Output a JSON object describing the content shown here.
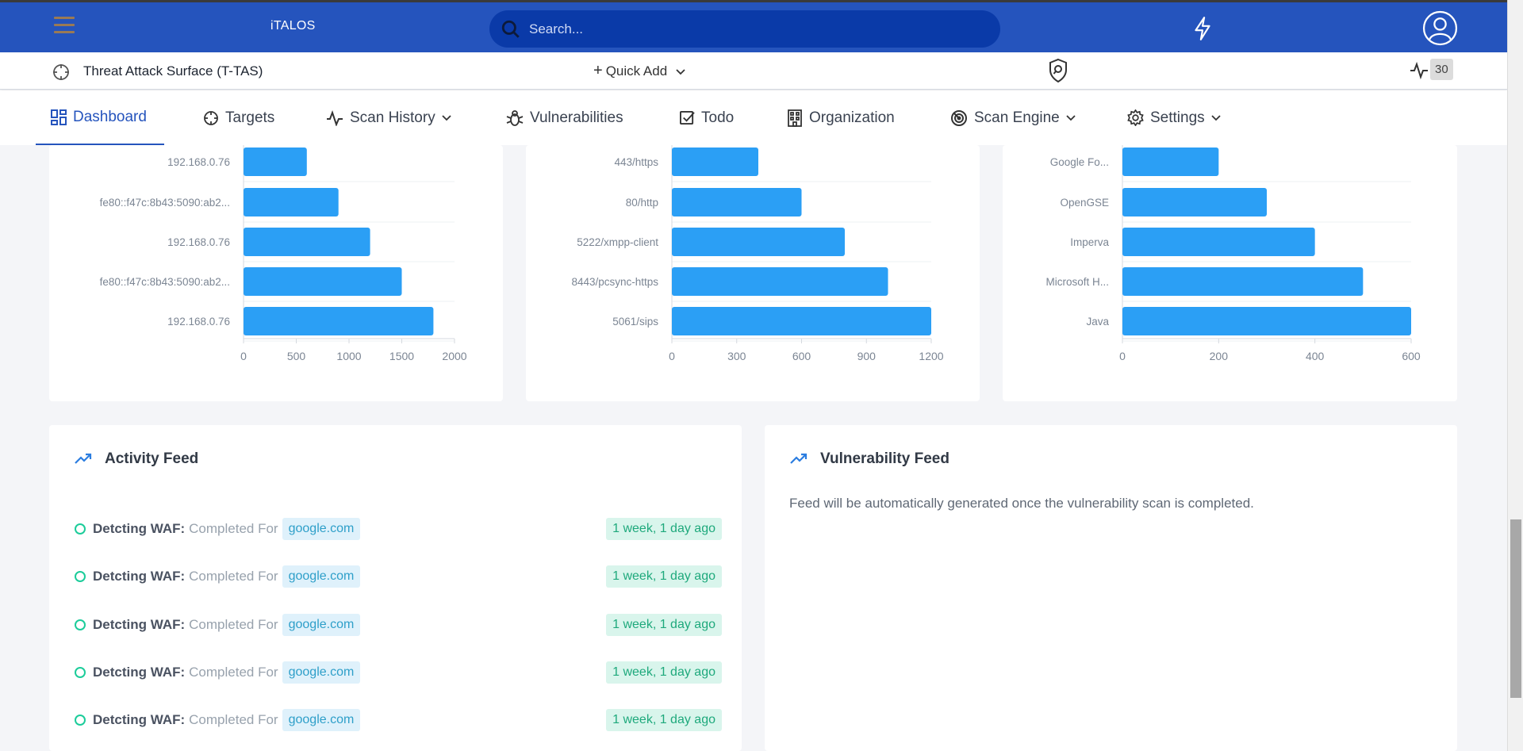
{
  "app": {
    "brand": "iTALOS"
  },
  "search": {
    "placeholder": "Search..."
  },
  "subbar": {
    "project": "Threat Attack Surface (T-TAS)",
    "quick_add": "Quick Add",
    "activity_count": "30"
  },
  "nav": [
    {
      "label": "Dashboard",
      "icon": "dashboard-icon",
      "active": true
    },
    {
      "label": "Targets",
      "icon": "crosshair-icon"
    },
    {
      "label": "Scan History",
      "icon": "pulse-icon",
      "dropdown": true
    },
    {
      "label": "Vulnerabilities",
      "icon": "bug-icon"
    },
    {
      "label": "Todo",
      "icon": "checkbox-icon"
    },
    {
      "label": "Organization",
      "icon": "building-icon"
    },
    {
      "label": "Scan Engine",
      "icon": "radar-icon",
      "dropdown": true
    },
    {
      "label": "Settings",
      "icon": "gear-icon",
      "dropdown": true
    }
  ],
  "colors": {
    "primary": "#2554bd",
    "bar": "#2b9ff5",
    "success": "#1ccc9a"
  },
  "chart_data": [
    {
      "type": "bar",
      "orientation": "horizontal",
      "categories": [
        "192.168.0.76",
        "fe80::f47c:8b43:5090:ab2...",
        "192.168.0.76",
        "fe80::f47c:8b43:5090:ab2...",
        "192.168.0.76"
      ],
      "values": [
        600,
        900,
        1200,
        1500,
        1800
      ],
      "xticks": [
        0,
        500,
        1000,
        1500,
        2000
      ],
      "xlim": [
        0,
        2000
      ]
    },
    {
      "type": "bar",
      "orientation": "horizontal",
      "categories": [
        "443/https",
        "80/http",
        "5222/xmpp-client",
        "8443/pcsync-https",
        "5061/sips"
      ],
      "values": [
        400,
        600,
        800,
        1000,
        1200
      ],
      "xticks": [
        0,
        300,
        600,
        900,
        1200
      ],
      "xlim": [
        0,
        1200
      ]
    },
    {
      "type": "bar",
      "orientation": "horizontal",
      "categories": [
        "Google Fo...",
        "OpenGSE",
        "Imperva",
        "Microsoft H...",
        "Java"
      ],
      "values": [
        200,
        300,
        400,
        500,
        600
      ],
      "xticks": [
        0,
        200,
        400,
        600
      ],
      "xlim": [
        0,
        600
      ]
    }
  ],
  "activity_feed": {
    "title": "Activity Feed",
    "items": [
      {
        "title": "Detcting WAF:",
        "desc": "Completed For",
        "target": "google.com",
        "time": "1 week, 1 day ago"
      },
      {
        "title": "Detcting WAF:",
        "desc": "Completed For",
        "target": "google.com",
        "time": "1 week, 1 day ago"
      },
      {
        "title": "Detcting WAF:",
        "desc": "Completed For",
        "target": "google.com",
        "time": "1 week, 1 day ago"
      },
      {
        "title": "Detcting WAF:",
        "desc": "Completed For",
        "target": "google.com",
        "time": "1 week, 1 day ago"
      },
      {
        "title": "Detcting WAF:",
        "desc": "Completed For",
        "target": "google.com",
        "time": "1 week, 1 day ago"
      }
    ]
  },
  "vulnerability_feed": {
    "title": "Vulnerability Feed",
    "message": "Feed will be automatically generated once the vulnerability scan is completed."
  }
}
